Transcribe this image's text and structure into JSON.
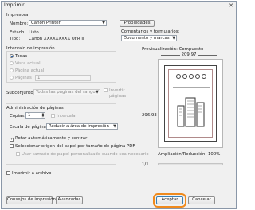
{
  "window": {
    "title": "Imprimir",
    "close_glyph": "✕"
  },
  "printer": {
    "section_label": "Impresora",
    "name_label": "Nombre:",
    "name_value": "Canon Printer",
    "properties_button": "Propiedades",
    "status_label": "Estado:",
    "status_value": "Listo",
    "type_label": "Tipo:",
    "type_value": "Canon XXXXXXXXX UFR II",
    "comments_label": "Comentarios y formularios:",
    "comments_value": "Documento y marcas"
  },
  "range": {
    "section_label": "Intervalo de impresión",
    "all_label": "Todas",
    "current_view_label": "Vista actual",
    "current_page_label": "Página actual",
    "pages_label": "Páginas",
    "pages_value": "1",
    "subset_label": "Subconjunto:",
    "subset_value": "Todas las páginas del rango",
    "reverse_label_1": "Invertir",
    "reverse_label_2": "páginas"
  },
  "handling": {
    "section_label": "Administración de páginas",
    "copies_label": "Copias:",
    "copies_value": "1",
    "collate_label": "Intercalar",
    "scaling_label": "Escala de páginas:",
    "scaling_value": "Reducir a área de impresión",
    "auto_rotate_label": "Rotar automáticamente y centrar",
    "auto_rotate_checked": true,
    "paper_source_label": "Seleccionar origen del papel por tamaño de página PDF",
    "custom_paper_label": "Usar tamaño de papel personalizado cuando sea necesario"
  },
  "print_to_file_label": "Imprimir a archivo",
  "preview": {
    "label": "Previsualización: Compuesto",
    "width_value": "209.97",
    "height_value": "296.93",
    "zoom_label": "Ampliación/Reducción: 100%",
    "page_counter": "1/1"
  },
  "buttons": {
    "tips": "Consejos de impresión",
    "advanced": "Avanzadas",
    "accept": "Aceptar",
    "cancel": "Cancelar"
  },
  "colors": {
    "highlight_ring": "#f08a1c",
    "accent": "#1d5aa8"
  },
  "icons": [
    "close-icon",
    "dropdown-arrow-icon",
    "radio-icon",
    "checkbox-icon",
    "spin-arrow-icon",
    "document-preview-icon"
  ]
}
